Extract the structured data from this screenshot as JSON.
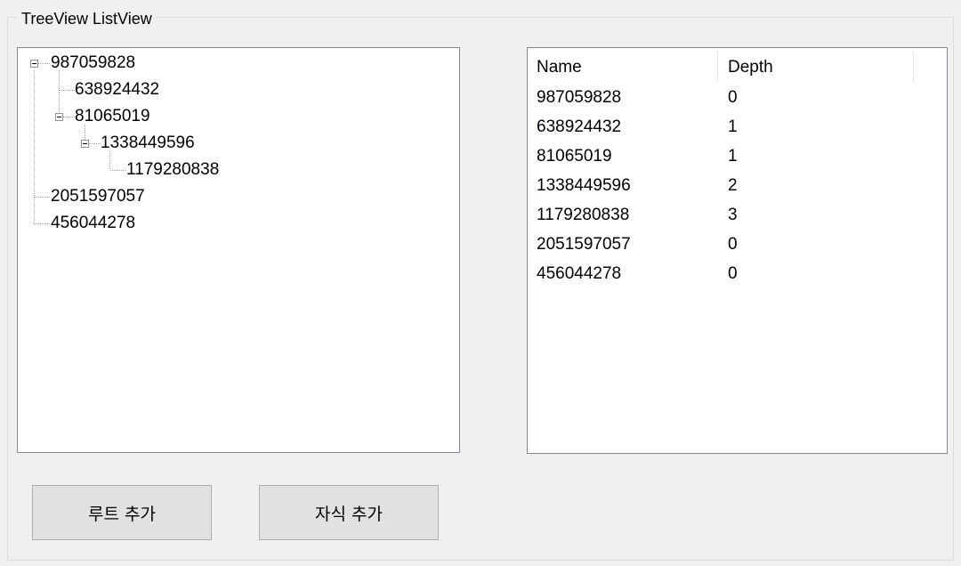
{
  "group": {
    "title": "TreeView  ListView"
  },
  "tree": {
    "nodes": [
      {
        "text": "987059828",
        "depth": 0,
        "expanded": true
      },
      {
        "text": "638924432",
        "depth": 1,
        "expanded": false
      },
      {
        "text": "81065019",
        "depth": 1,
        "expanded": true
      },
      {
        "text": "1338449596",
        "depth": 2,
        "expanded": true
      },
      {
        "text": "1179280838",
        "depth": 3,
        "expanded": false
      },
      {
        "text": "2051597057",
        "depth": 0,
        "expanded": false
      },
      {
        "text": "456044278",
        "depth": 0,
        "expanded": false
      }
    ]
  },
  "list": {
    "columns": [
      "Name",
      "Depth"
    ],
    "rows": [
      [
        "987059828",
        "0"
      ],
      [
        "638924432",
        "1"
      ],
      [
        "81065019",
        "1"
      ],
      [
        "1338449596",
        "2"
      ],
      [
        "1179280838",
        "3"
      ],
      [
        "2051597057",
        "0"
      ],
      [
        "456044278",
        "0"
      ]
    ]
  },
  "buttons": {
    "add_root": "루트 추가",
    "add_child": "자식 추가"
  }
}
